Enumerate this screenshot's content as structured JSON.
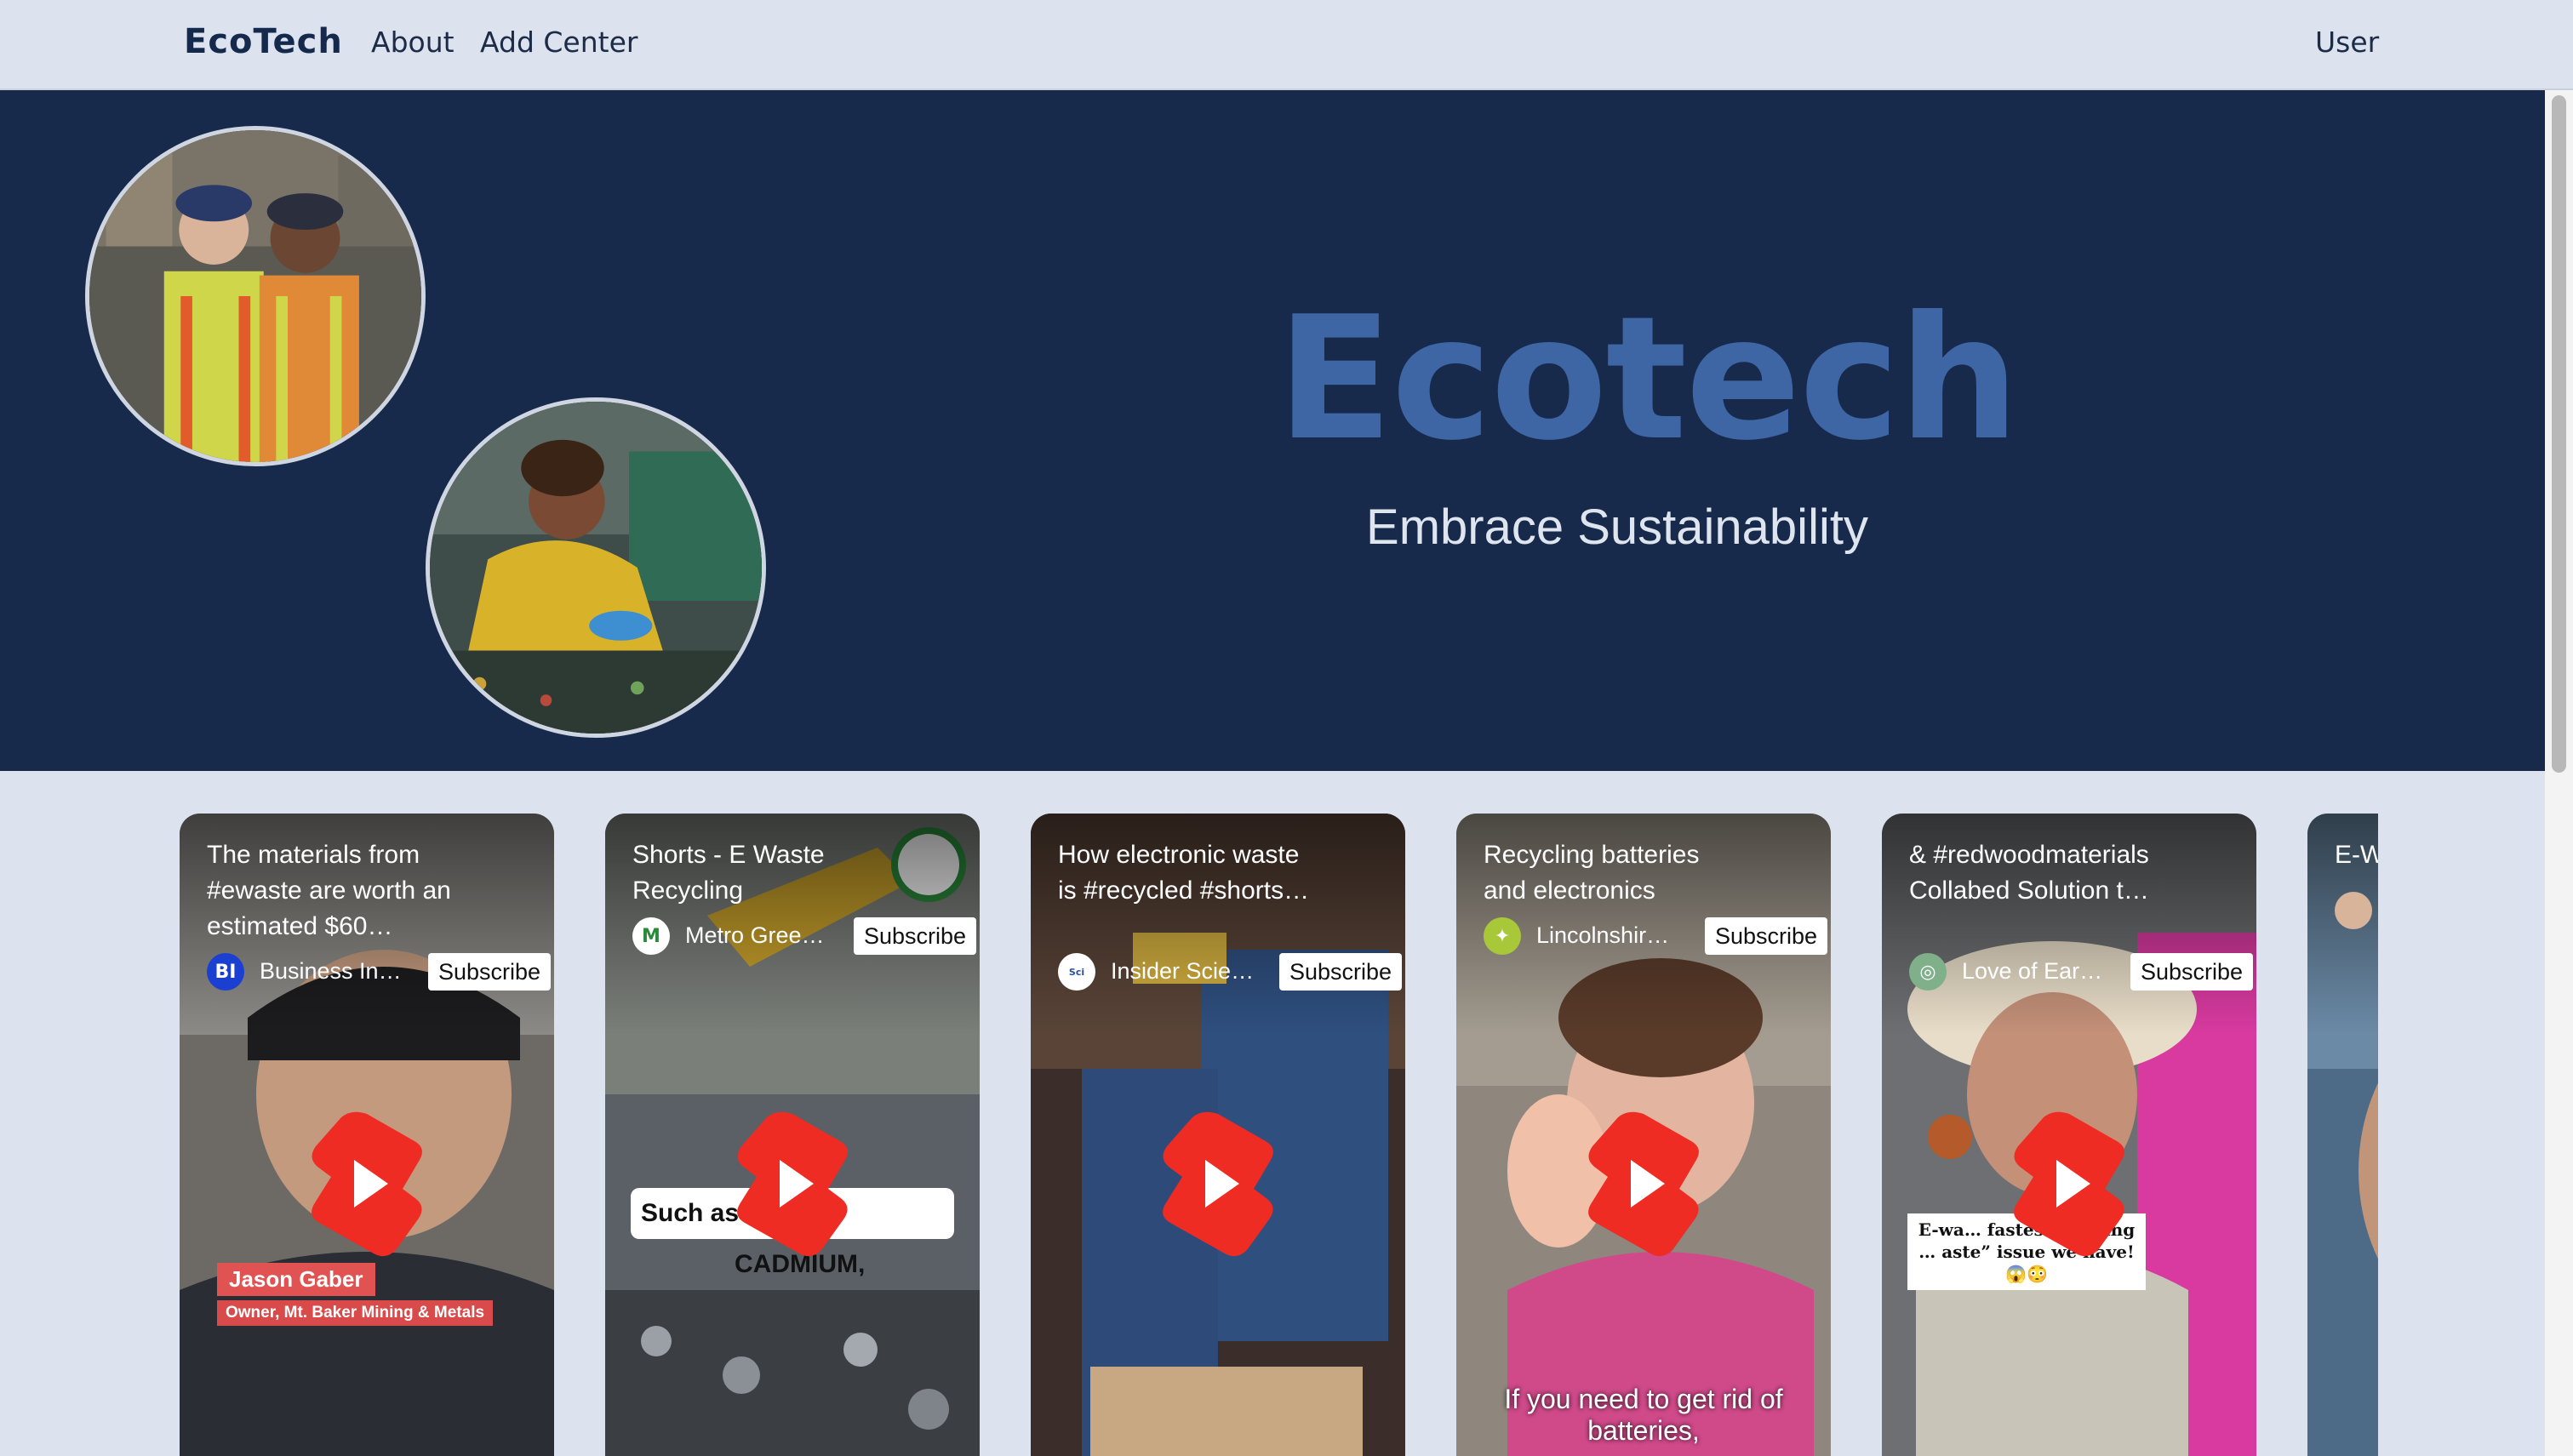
{
  "navbar": {
    "brand": "EcoTech",
    "links": [
      "About",
      "Add Center"
    ],
    "user": "User"
  },
  "hero": {
    "title": "Ecotech",
    "subtitle": "Embrace Sustainability",
    "colors": {
      "background": "#182a4c",
      "title": "#3e65a4"
    }
  },
  "videos": [
    {
      "title": "The materials from #ewaste are worth an estimated $60…",
      "channel": "Business In…",
      "channel_avatar": "BI",
      "subscribe": "Subscribe",
      "name_tag": "Jason Gaber",
      "role_tag": "Owner, Mt. Baker Mining & Metals"
    },
    {
      "title": "Shorts - E Waste Recycling",
      "channel": "Metro Gree…",
      "subscribe": "Subscribe",
      "caption_left": "Such as",
      "caption_right": "CADMIUM,"
    },
    {
      "title": "How electronic waste is #recycled #shorts…",
      "channel": "Insider Scie…",
      "subscribe": "Subscribe"
    },
    {
      "title": "Recycling batteries and electronics",
      "channel": "Lincolnshir…",
      "subscribe": "Subscribe",
      "bottom_caption": "If you need to get rid of batteries,"
    },
    {
      "title": "& #redwoodmaterials Collabed Solution t…",
      "channel": "Love of Ear…",
      "subscribe": "Subscribe",
      "caption": "E-wa… fastest growing … aste” issue we have!😱😳"
    },
    {
      "title": "E-W"
    }
  ],
  "icons": {
    "play": "youtube-shorts-play-icon",
    "avatar": "channel-avatar-icon"
  }
}
